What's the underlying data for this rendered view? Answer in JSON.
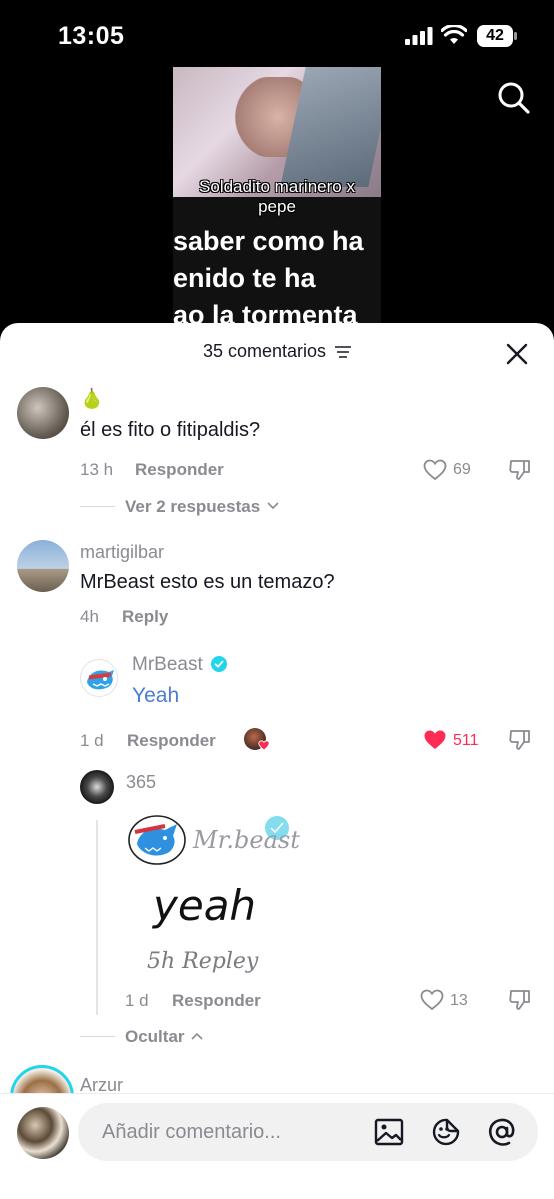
{
  "status_bar": {
    "time": "13:05",
    "battery": "42"
  },
  "video": {
    "caption_small": "Soldadito marinero x\npepe",
    "caption_big": "saber como ha\nenido te ha\nao la tormenta"
  },
  "sheet": {
    "title": "35 comentarios"
  },
  "comments": [
    {
      "author_emoji": "🍐",
      "text": "él es fito o fitipaldis?",
      "time": "13 h",
      "reply_label": "Responder",
      "likes": "69",
      "view_replies": "Ver 2 respuestas"
    },
    {
      "author": "martigilbar",
      "text": "MrBeast esto es un temazo?",
      "time": "4h",
      "reply_label": "Reply"
    },
    {
      "author": "MrBeast",
      "text": "Yeah",
      "time": "1 d",
      "reply_label": "Responder",
      "likes": "511"
    },
    {
      "author": "365",
      "sketch_text": "Mr.beast",
      "sketch_reply": "yeah",
      "sketch_meta": "5h     Repley",
      "time": "1 d",
      "reply_label": "Responder",
      "likes": "13",
      "hide_label": "Ocultar"
    },
    {
      "author": "Arzur"
    }
  ],
  "input": {
    "placeholder": "Añadir comentario..."
  },
  "colors": {
    "accent_blue": "#4a7fcf",
    "like_red": "#fe2c55",
    "verified": "#20d5ec"
  }
}
